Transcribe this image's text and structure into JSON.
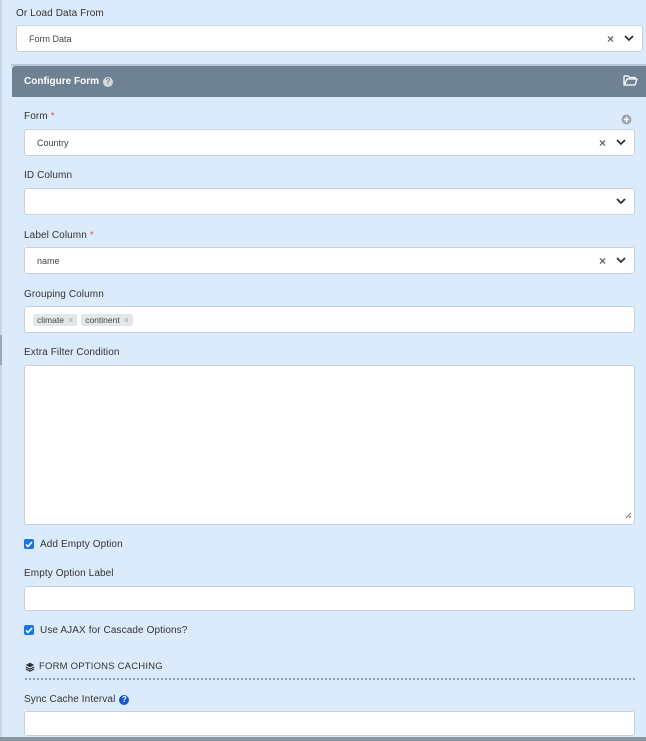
{
  "load_from": {
    "label": "Or Load Data From",
    "value": "Form Data"
  },
  "panel": {
    "title": "Configure Form",
    "help_glyph": "?"
  },
  "form_field": {
    "label": "Form",
    "required_mark": "*",
    "value": "Country"
  },
  "id_column": {
    "label": "ID Column",
    "value": ""
  },
  "label_column": {
    "label": "Label Column",
    "required_mark": "*",
    "value": "name"
  },
  "grouping_column": {
    "label": "Grouping Column",
    "tags": [
      "climate",
      "continent"
    ]
  },
  "extra_filter": {
    "label": "Extra Filter Condition",
    "value": ""
  },
  "add_empty_option": {
    "label": "Add Empty Option",
    "checked": true
  },
  "empty_option_label": {
    "label": "Empty Option Label",
    "value": ""
  },
  "use_ajax": {
    "label": "Use AJAX for Cascade Options?",
    "checked": true
  },
  "caching_section": {
    "title": "FORM OPTIONS CACHING",
    "icon": "layers-icon"
  },
  "sync_cache": {
    "label": "Sync Cache Interval",
    "help_glyph": "?",
    "value": ""
  },
  "glyphs": {
    "clear": "×",
    "tag_remove": "×"
  },
  "colors": {
    "page_bg": "#dcebfb",
    "panel_header": "#6f8294",
    "checkbox": "#1a73e8",
    "required": "#e55353"
  }
}
